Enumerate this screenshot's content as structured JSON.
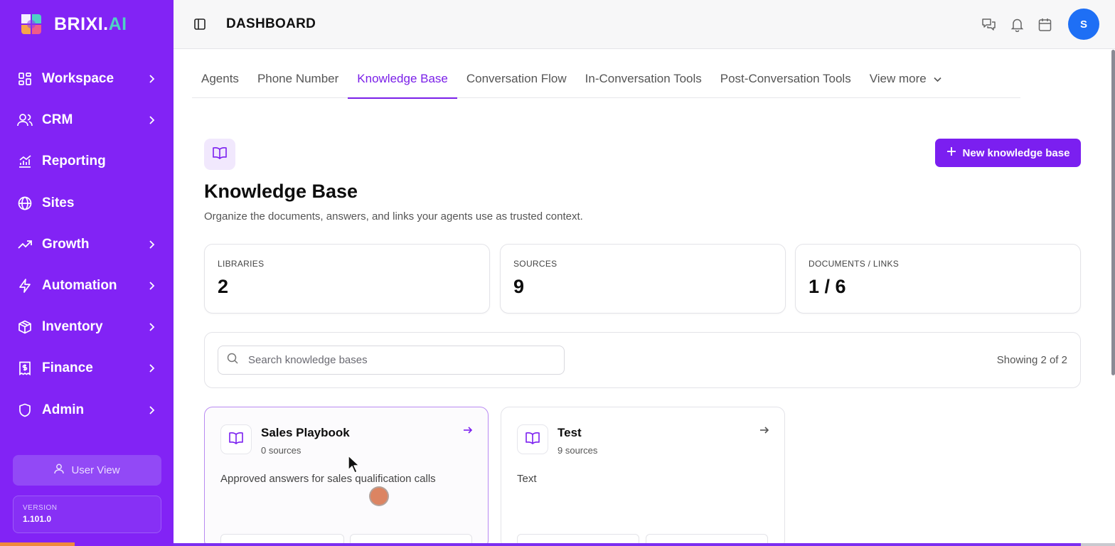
{
  "app": {
    "logo_text": "BRIXI.",
    "logo_text_accent": "AI",
    "page_title": "DASHBOARD",
    "avatar_initial": "S"
  },
  "sidebar": {
    "items": [
      {
        "label": "Workspace",
        "icon": "grid-icon",
        "has_chevron": true
      },
      {
        "label": "CRM",
        "icon": "users-icon",
        "has_chevron": true
      },
      {
        "label": "Reporting",
        "icon": "chart-icon",
        "has_chevron": false
      },
      {
        "label": "Sites",
        "icon": "globe-icon",
        "has_chevron": false
      },
      {
        "label": "Growth",
        "icon": "trending-up-icon",
        "has_chevron": true
      },
      {
        "label": "Automation",
        "icon": "zap-icon",
        "has_chevron": true
      },
      {
        "label": "Inventory",
        "icon": "package-icon",
        "has_chevron": true
      },
      {
        "label": "Finance",
        "icon": "receipt-icon",
        "has_chevron": true
      },
      {
        "label": "Admin",
        "icon": "shield-icon",
        "has_chevron": true
      }
    ],
    "user_view_label": "User View",
    "version_label": "VERSION",
    "version_value": "1.101.0"
  },
  "tabs": [
    {
      "label": "Agents",
      "active": false
    },
    {
      "label": "Phone Number",
      "active": false
    },
    {
      "label": "Knowledge Base",
      "active": true
    },
    {
      "label": "Conversation Flow",
      "active": false
    },
    {
      "label": "In-Conversation Tools",
      "active": false
    },
    {
      "label": "Post-Conversation Tools",
      "active": false
    },
    {
      "label": "View more",
      "active": false
    }
  ],
  "main": {
    "new_button_label": "New knowledge base",
    "title": "Knowledge Base",
    "subtitle": "Organize the documents, answers, and links your agents use as trusted context.",
    "stats": [
      {
        "label": "LIBRARIES",
        "value": "2"
      },
      {
        "label": "SOURCES",
        "value": "9"
      },
      {
        "label": "DOCUMENTS / LINKS",
        "value": "1 / 6"
      }
    ],
    "search": {
      "placeholder": "Search knowledge bases",
      "value": ""
    },
    "showing_text": "Showing 2 of 2",
    "cards": [
      {
        "title": "Sales Playbook",
        "sources": "0 sources",
        "description": "Approved answers for sales qualification calls"
      },
      {
        "title": "Test",
        "sources": "9 sources",
        "description": "Text"
      }
    ]
  },
  "colors": {
    "brand": "#8223f5",
    "accent": "#7b1ff0",
    "avatar": "#1e6ff5"
  }
}
